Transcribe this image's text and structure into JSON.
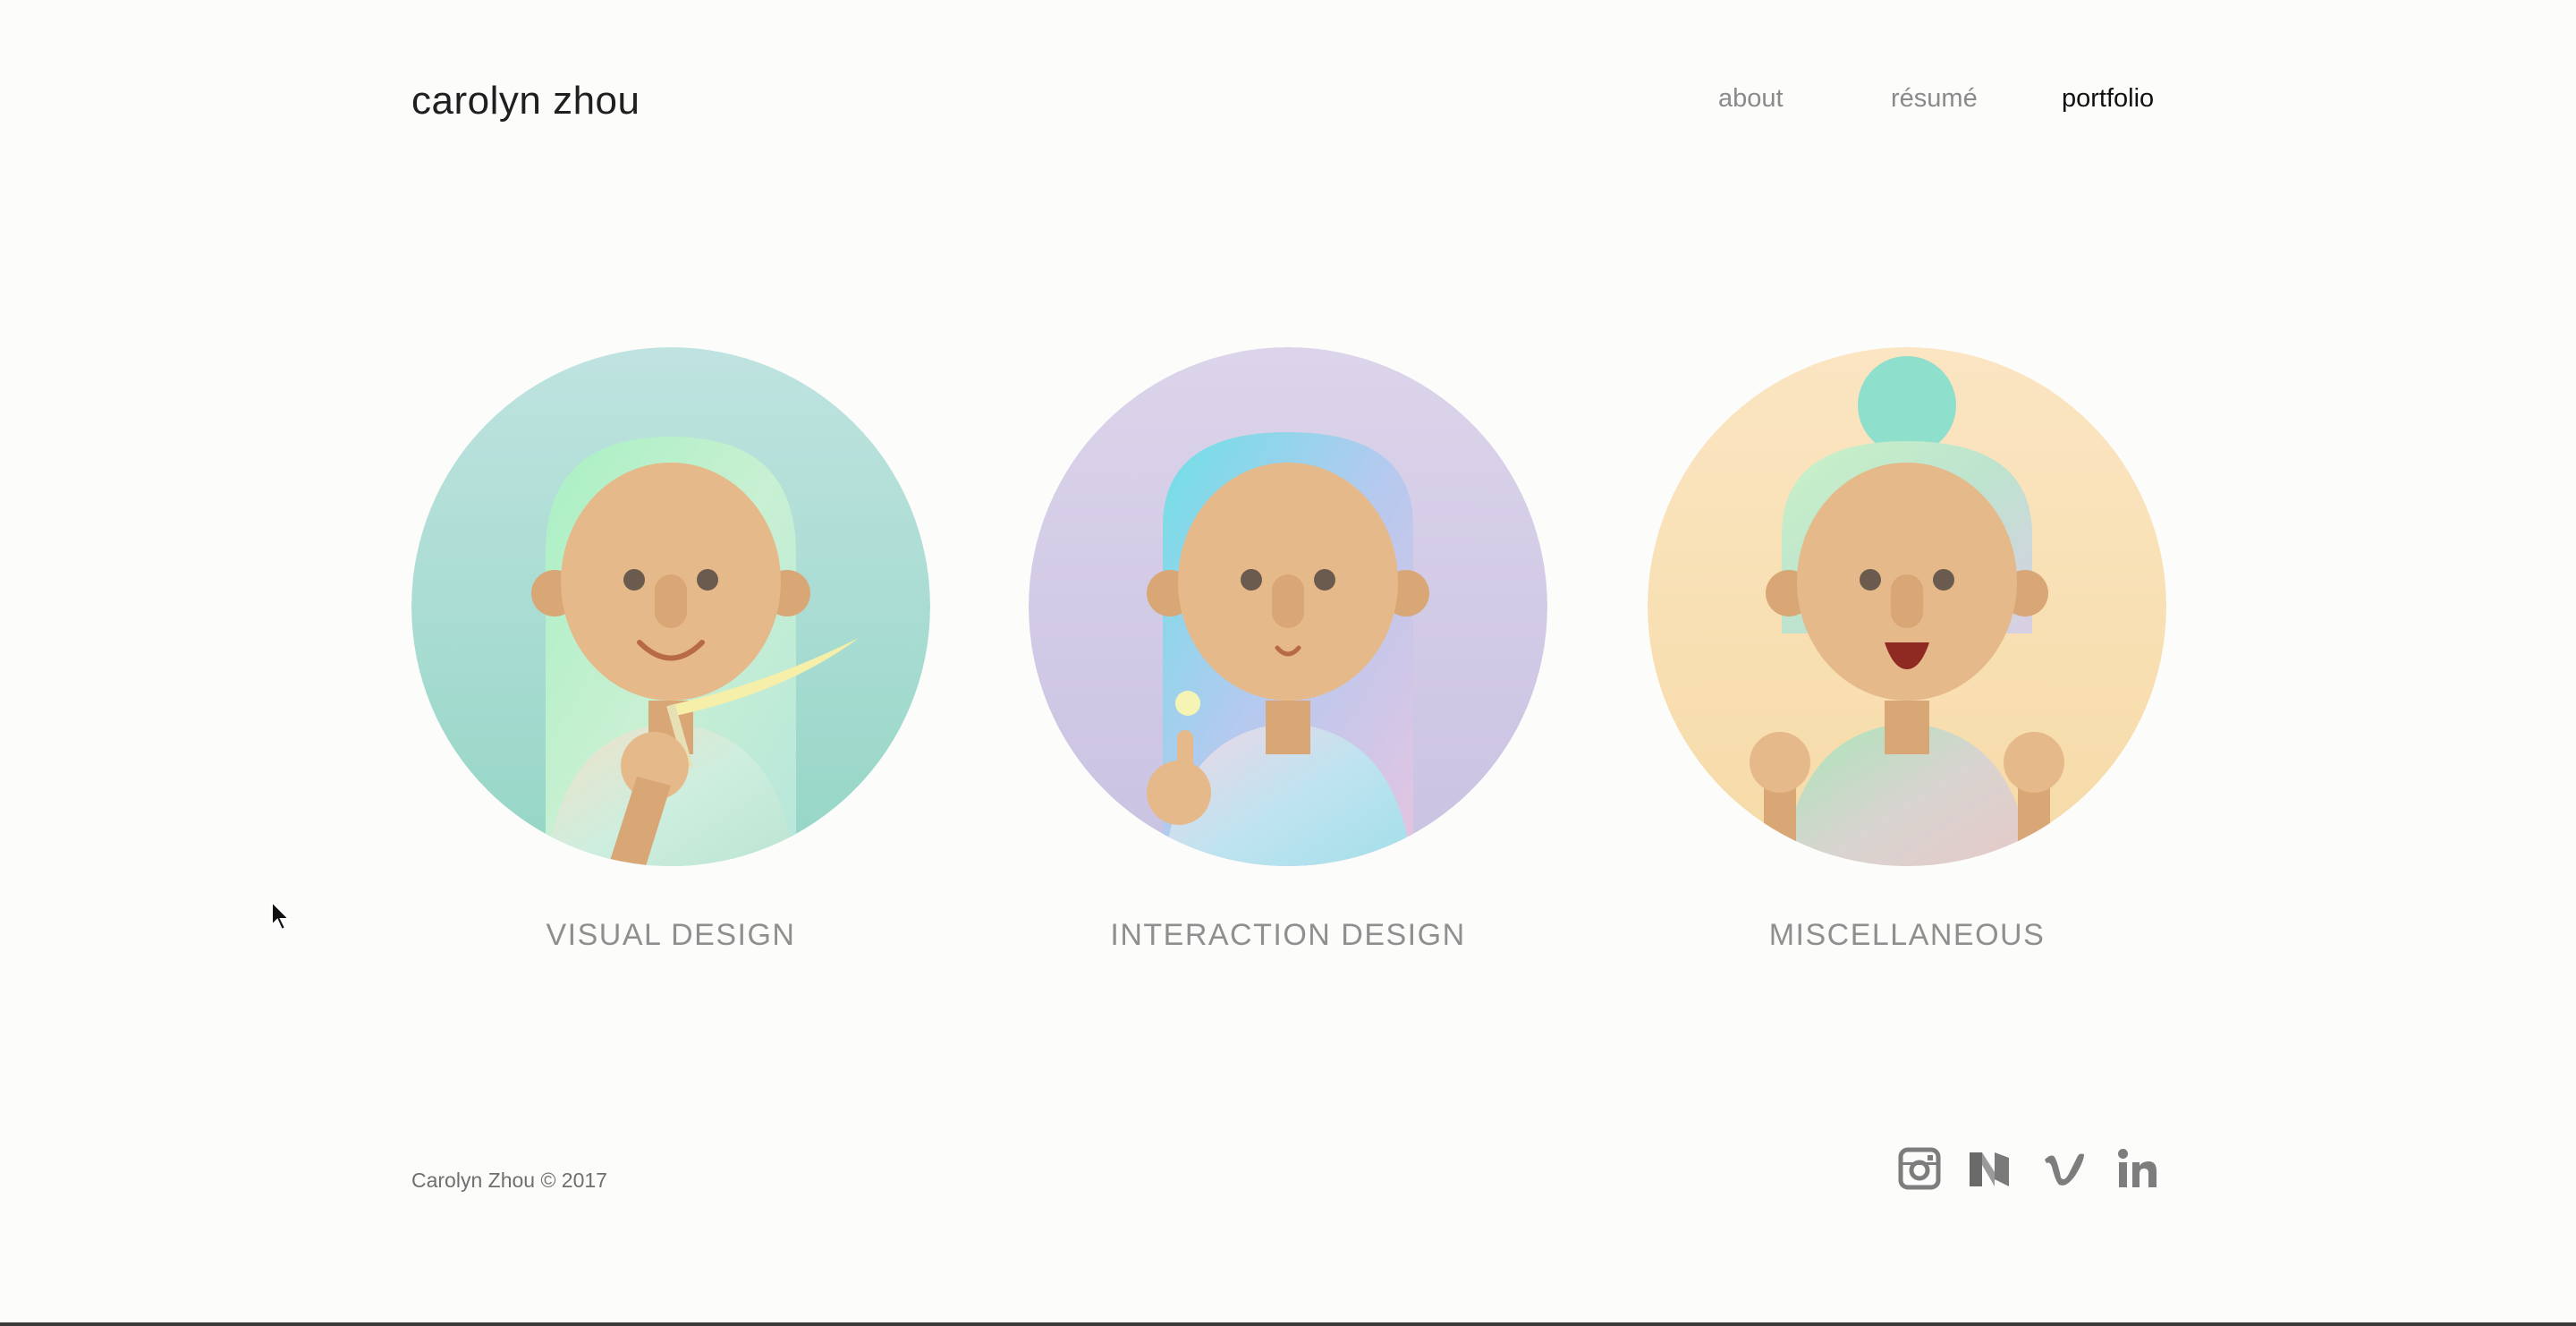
{
  "header": {
    "logo": "carolyn zhou",
    "nav": [
      {
        "label": "about"
      },
      {
        "label": "résumé"
      },
      {
        "label": "portfolio",
        "active": true
      }
    ]
  },
  "cards": [
    {
      "label": "VISUAL DESIGN",
      "bg": [
        "#bfe3e0",
        "#95d6c6"
      ],
      "icon": "girl-with-pencil-illustration"
    },
    {
      "label": "INTERACTION DESIGN",
      "bg": [
        "#dcd4ea",
        "#c9c2e2"
      ],
      "icon": "girl-pointing-illustration"
    },
    {
      "label": "MISCELLANEOUS",
      "bg": [
        "#fbe5c2",
        "#f6dba7"
      ],
      "icon": "girl-with-bun-illustration"
    }
  ],
  "footer": {
    "copyright": "Carolyn Zhou © 2017",
    "social": [
      {
        "icon": "instagram-icon"
      },
      {
        "icon": "medium-icon"
      },
      {
        "icon": "vimeo-icon"
      },
      {
        "icon": "linkedin-icon"
      }
    ]
  },
  "colors": {
    "skin": "#e6b98a",
    "skin_dark": "#d9a676",
    "text_muted": "#8f8f8f",
    "icon_gray": "#7d7d7d"
  }
}
